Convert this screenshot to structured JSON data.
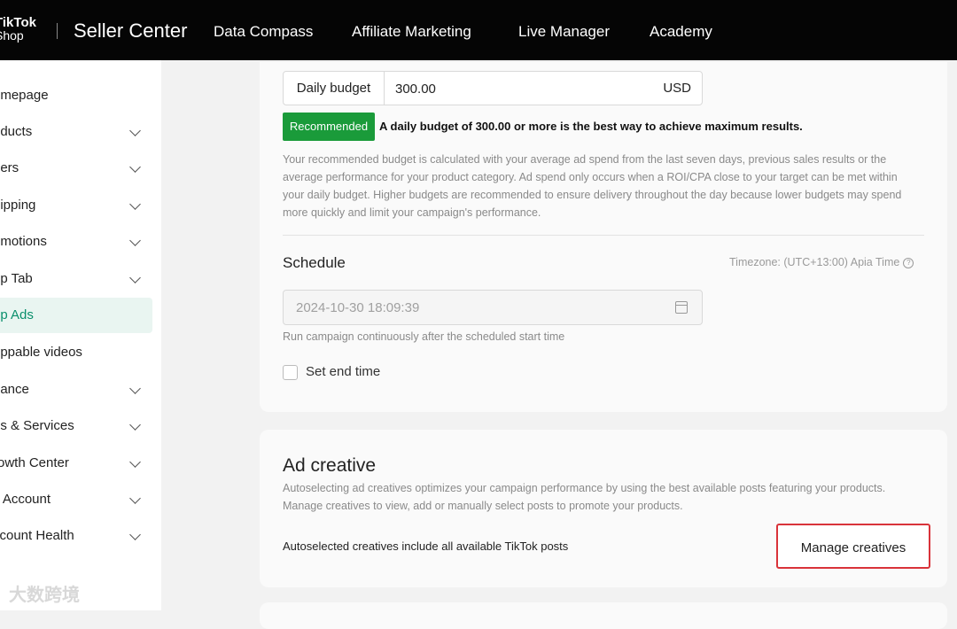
{
  "nav": {
    "logo_line1": "TikTok",
    "logo_line2": "Shop",
    "brand": "Seller Center",
    "items": [
      "Data Compass",
      "Affiliate Marketing",
      "Live Manager",
      "Academy"
    ]
  },
  "sidebar": {
    "items": [
      {
        "label": "omepage"
      },
      {
        "label": "oducts"
      },
      {
        "label": "ders"
      },
      {
        "label": "hipping"
      },
      {
        "label": "omotions"
      },
      {
        "label": "op Tab"
      },
      {
        "label": "op Ads"
      },
      {
        "label": "oppable videos"
      },
      {
        "label": "nance"
      },
      {
        "label": "ps & Services"
      },
      {
        "label": "rowth Center"
      },
      {
        "label": "y Account"
      },
      {
        "label": "ccount Health"
      }
    ]
  },
  "budget": {
    "label": "Daily budget",
    "value": "300.00",
    "unit": "USD",
    "badge": "Recommended",
    "recommendation": "A daily budget of 300.00 or more is the best way to achieve maximum results.",
    "description": "Your recommended budget is calculated with your average ad spend from the last seven days, previous sales results or the average performance for your product category. Ad spend only occurs when a ROI/CPA close to your target can be met within your daily budget. Higher budgets are recommended to ensure delivery throughout the day because lower budgets may spend more quickly and limit your campaign's performance."
  },
  "schedule": {
    "title": "Schedule",
    "timezone": "Timezone: (UTC+13:00) Apia Time",
    "start": "2024-10-30 18:09:39",
    "hint": "Run campaign continuously after the scheduled start time",
    "end_label": "Set end time"
  },
  "ad_creative": {
    "title": "Ad creative",
    "description": "Autoselecting ad creatives optimizes your campaign performance by using the best available posts featuring your products. Manage creatives to view, add or manually select posts to promote your products.",
    "auto_text": "Autoselected creatives include all available TikTok posts",
    "manage_button": "Manage creatives"
  },
  "watermark": "大数跨境",
  "colors": {
    "accent": "#0a8f6c",
    "badge": "#1a9b3a",
    "highlight": "#d9333a"
  }
}
